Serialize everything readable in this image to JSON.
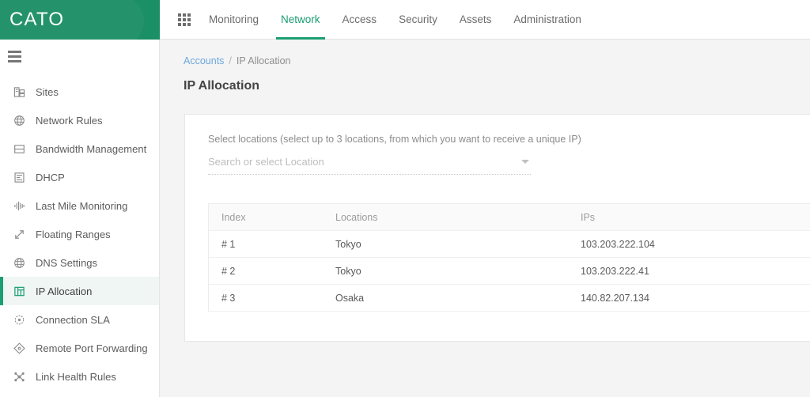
{
  "brand": {
    "name": "CATO",
    "green": "#1b8f66",
    "accent": "#1b9e72"
  },
  "topnav": {
    "apps_icon": "grid-icon",
    "items": [
      {
        "label": "Monitoring",
        "active": false
      },
      {
        "label": "Network",
        "active": true
      },
      {
        "label": "Access",
        "active": false
      },
      {
        "label": "Security",
        "active": false
      },
      {
        "label": "Assets",
        "active": false
      },
      {
        "label": "Administration",
        "active": false
      }
    ]
  },
  "sidebar": {
    "toggle_icon": "hamburger-icon",
    "items": [
      {
        "label": "Sites",
        "icon": "sites-icon",
        "active": false
      },
      {
        "label": "Network Rules",
        "icon": "globe-icon",
        "active": false
      },
      {
        "label": "Bandwidth Management",
        "icon": "bandwidth-icon",
        "active": false
      },
      {
        "label": "DHCP",
        "icon": "dhcp-list-icon",
        "active": false
      },
      {
        "label": "Last Mile Monitoring",
        "icon": "waveform-icon",
        "active": false
      },
      {
        "label": "Floating Ranges",
        "icon": "expand-arrows-icon",
        "active": false
      },
      {
        "label": "DNS Settings",
        "icon": "globe-icon",
        "active": false
      },
      {
        "label": "IP Allocation",
        "icon": "ip-allocation-icon",
        "active": true
      },
      {
        "label": "Connection SLA",
        "icon": "target-icon",
        "active": false
      },
      {
        "label": "Remote Port Forwarding",
        "icon": "diamond-icon",
        "active": false
      },
      {
        "label": "Link Health Rules",
        "icon": "network-nodes-icon",
        "active": false
      }
    ]
  },
  "breadcrumb": {
    "parent": "Accounts",
    "separator": "/",
    "current": "IP Allocation"
  },
  "page": {
    "title": "IP Allocation"
  },
  "card": {
    "label": "Select locations (select up to 3 locations, from which you want to receive a unique IP)",
    "select": {
      "placeholder": "Search or select Location",
      "value": "",
      "caret_icon": "chevron-down-icon"
    }
  },
  "table": {
    "columns": [
      "Index",
      "Locations",
      "IPs"
    ],
    "rows": [
      {
        "index": "# 1",
        "location": "Tokyo",
        "ip": "103.203.222.104"
      },
      {
        "index": "# 2",
        "location": "Tokyo",
        "ip": "103.203.222.41"
      },
      {
        "index": "# 3",
        "location": "Osaka",
        "ip": "140.82.207.134"
      }
    ]
  }
}
